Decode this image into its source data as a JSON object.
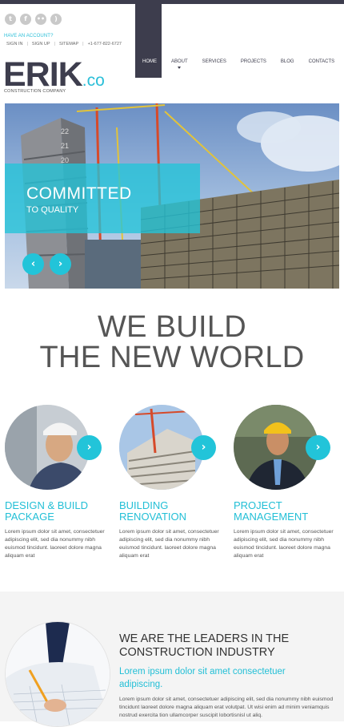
{
  "header": {
    "social_icons": [
      "twitter-icon",
      "facebook-icon",
      "flickr-icon",
      "rss-icon"
    ],
    "have_account": "HAVE AN ACCOUNT?",
    "sign_in": "SIGN IN",
    "sign_up": "SIGN UP",
    "sitemap": "SITEMAP",
    "phone": "+1-677-822-6727",
    "logo_main": "ERIK",
    "logo_ext": ".co",
    "logo_sub": "CONSTRUCTION COMPANY"
  },
  "nav": {
    "items": [
      {
        "label": "HOME"
      },
      {
        "label": "ABOUT"
      },
      {
        "label": "SERVICES"
      },
      {
        "label": "PROJECTS"
      },
      {
        "label": "BLOG"
      },
      {
        "label": "CONTACTS"
      }
    ]
  },
  "hero": {
    "title": "COMMITTED",
    "subtitle": "TO QUALITY",
    "prev_glyph": "‹",
    "next_glyph": "›"
  },
  "headline": {
    "line1": "WE BUILD",
    "line2": "THE NEW WORLD"
  },
  "services": [
    {
      "title_line1": "DESIGN & BUILD",
      "title_line2": "PACKAGE",
      "text": "Lorem ipsum dolor sit amet, consectetuer adipiscing elit, sed dia nonummy nibh euismod tincidunt. laoreet dolore magna aliquam erat"
    },
    {
      "title_line1": "BUILDING",
      "title_line2": "RENOVATION",
      "text": "Lorem ipsum dolor sit amet, consectetuer adipiscing elit, sed dia nonummy nibh euismod tincidunt. laoreet dolore magna aliquam erat"
    },
    {
      "title_line1": "PROJECT",
      "title_line2": "MANAGEMENT",
      "text": "Lorem ipsum dolor sit amet, consectetuer adipiscing elit, sed dia nonummy nibh euismod tincidunt. laoreet dolore magna aliquam erat"
    }
  ],
  "service_button_glyph": "›",
  "leaders": {
    "title_line1": "WE ARE THE LEADERS IN THE",
    "title_line2": "CONSTRUCTION INDUSTRY",
    "sub_line1": "Lorem ipsum dolor sit amet consectetuer",
    "sub_line2": "adipiscing.",
    "text": "Lorem ipsum dolor sit amet, consectetuer adipiscing elit, sed dia nonummy nibh euismod tincidunt laoreet dolore magna aliquam erat volutpat. Ut wisi enim ad minim veniamquis nostrud exercita tion ullamcorper suscipit lobortisnisl ut aliq."
  },
  "colors": {
    "accent": "#22c4d9",
    "dark": "#3d3d4d"
  }
}
